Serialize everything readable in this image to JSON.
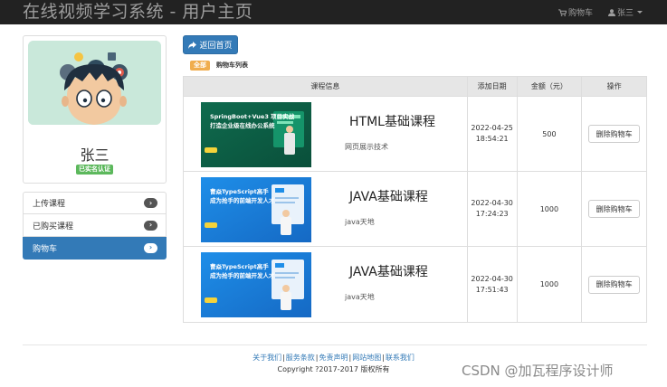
{
  "navbar": {
    "brand": "在线视频学习系统 - 用户主页",
    "cart_link": "购物车",
    "user_menu": "张三"
  },
  "profile": {
    "name": "张三",
    "badge": "已实名认证"
  },
  "menu": {
    "items": [
      {
        "label": "上传课程",
        "chevron": "›"
      },
      {
        "label": "已购买课程",
        "chevron": "›"
      },
      {
        "label": "购物车",
        "chevron": "›"
      }
    ]
  },
  "back_button": "返回首页",
  "section": {
    "all_label": "全部",
    "title": "购物车列表"
  },
  "table": {
    "headers": [
      "课程信息",
      "添加日期",
      "金额（元）",
      "操作"
    ],
    "rows": [
      {
        "thumb_line1": "SpringBoot+Vue3 项目实战",
        "thumb_line2": "打造企业级在线办公系统",
        "course_name": "HTML基础课程",
        "source": "网页展示技术",
        "date_line1": "2022-04-25",
        "date_line2": "18:54:21",
        "amount": "500",
        "action": "删除购物车"
      },
      {
        "thumb_line1": "曹焱TypeScript高手",
        "thumb_line2": "成为抢手的前端开发人才",
        "course_name": "JAVA基础课程",
        "source": "java天地",
        "date_line1": "2022-04-30",
        "date_line2": "17:24:23",
        "amount": "1000",
        "action": "删除购物车"
      },
      {
        "thumb_line1": "曹焱TypeScript高手",
        "thumb_line2": "成为抢手的前端开发人才",
        "course_name": "JAVA基础课程",
        "source": "java天地",
        "date_line1": "2022-04-30",
        "date_line2": "17:51:43",
        "amount": "1000",
        "action": "删除购物车"
      }
    ]
  },
  "footer": {
    "links": [
      "关于我们",
      "服务条款",
      "免责声明",
      "网站地图",
      "联系我们"
    ],
    "copyright": "Copyright ?2017-2017 版权所有"
  },
  "watermark": "CSDN @加瓦程序设计师",
  "colors": {
    "navbar_bg": "#222222",
    "primary": "#337ab7",
    "success": "#5cb85c",
    "warning": "#f0ad4e"
  }
}
